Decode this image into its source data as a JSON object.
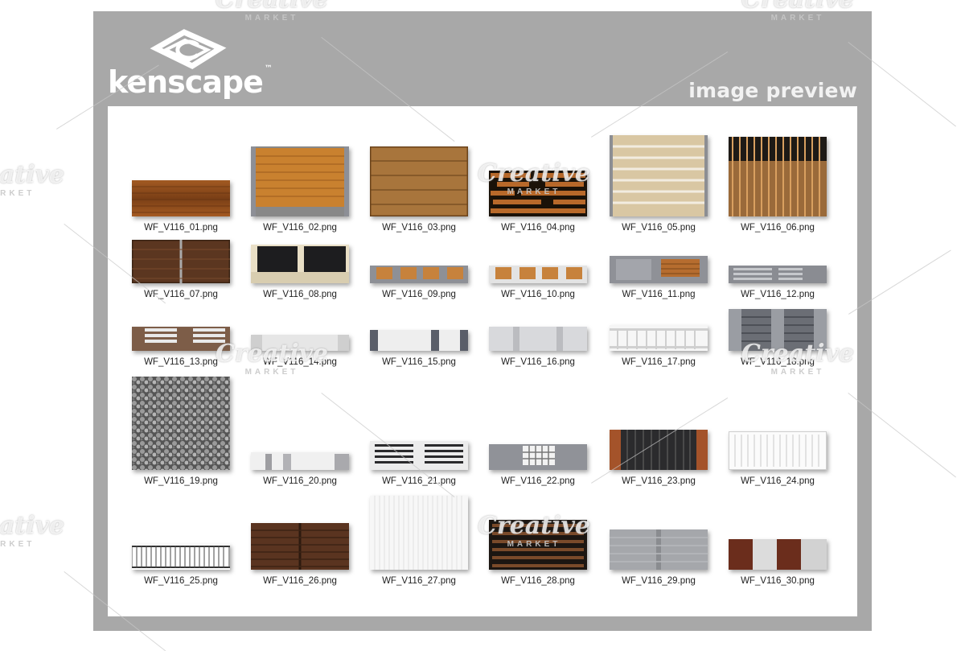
{
  "brand": {
    "name": "kenscape",
    "tm": "™"
  },
  "header": {
    "preview_label": "image preview"
  },
  "watermark": {
    "line1": "Creative",
    "line2": "MARKET"
  },
  "colors": {
    "frame": "#a8a8a8",
    "panel": "#ffffff",
    "caption": "#222222"
  },
  "files": [
    "WF_V116_01.png",
    "WF_V116_02.png",
    "WF_V116_03.png",
    "WF_V116_04.png",
    "WF_V116_05.png",
    "WF_V116_06.png",
    "WF_V116_07.png",
    "WF_V116_08.png",
    "WF_V116_09.png",
    "WF_V116_10.png",
    "WF_V116_11.png",
    "WF_V116_12.png",
    "WF_V116_13.png",
    "WF_V116_14.png",
    "WF_V116_15.png",
    "WF_V116_16.png",
    "WF_V116_17.png",
    "WF_V116_18.png",
    "WF_V116_19.png",
    "WF_V116_20.png",
    "WF_V116_21.png",
    "WF_V116_22.png",
    "WF_V116_23.png",
    "WF_V116_24.png",
    "WF_V116_25.png",
    "WF_V116_26.png",
    "WF_V116_27.png",
    "WF_V116_28.png",
    "WF_V116_29.png",
    "WF_V116_30.png"
  ]
}
